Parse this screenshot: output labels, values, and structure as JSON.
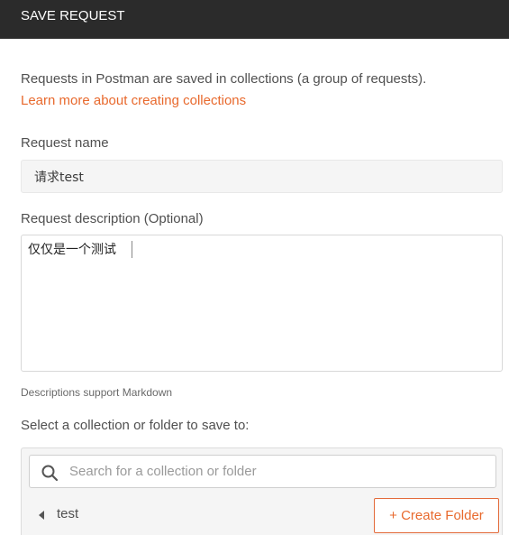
{
  "header": {
    "title": "SAVE REQUEST"
  },
  "intro": {
    "text": "Requests in Postman are saved in collections (a group of requests).",
    "link_text": "Learn more about creating collections"
  },
  "request_name": {
    "label": "Request name",
    "value": "请求test"
  },
  "request_description": {
    "label": "Request description (Optional)",
    "value": "仅仅是一个测试",
    "hint": "Descriptions support Markdown"
  },
  "collection_picker": {
    "label": "Select a collection or folder to save to:",
    "search_placeholder": "Search for a collection or folder",
    "collection_name": "test",
    "create_folder_label": "+ Create Folder"
  },
  "colors": {
    "accent": "#e8692d",
    "header_bg": "#2b2b2b"
  },
  "icons": {
    "search": "search-icon",
    "collapse": "caret-left-icon"
  }
}
